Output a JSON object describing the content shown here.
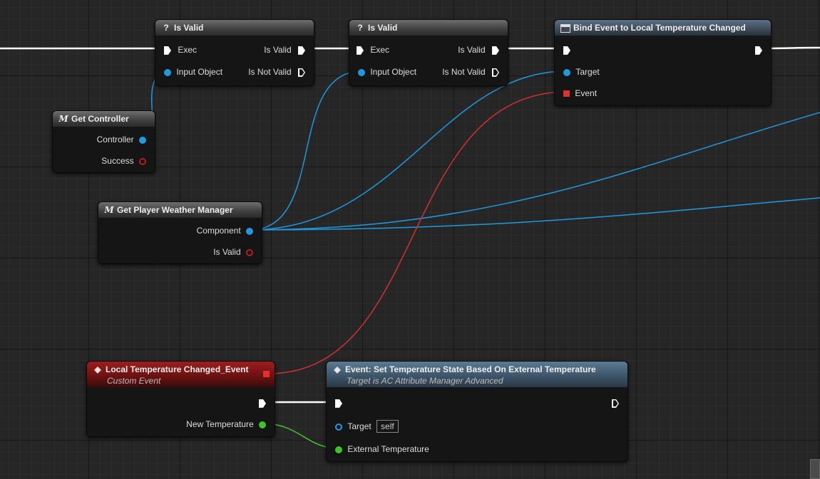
{
  "nodes": {
    "is_valid_1": {
      "title": "Is Valid",
      "icon": "?",
      "exec_in": "Exec",
      "input_object": "Input Object",
      "out_valid": "Is Valid",
      "out_not_valid": "Is Not Valid"
    },
    "is_valid_2": {
      "title": "Is Valid",
      "icon": "?",
      "exec_in": "Exec",
      "input_object": "Input Object",
      "out_valid": "Is Valid",
      "out_not_valid": "Is Not Valid"
    },
    "bind_event": {
      "title": "Bind Event to Local Temperature Changed",
      "target": "Target",
      "event": "Event"
    },
    "get_controller": {
      "title": "Get Controller",
      "icon": "M",
      "controller": "Controller",
      "success": "Success"
    },
    "get_weather": {
      "title": "Get Player Weather Manager",
      "icon": "M",
      "component": "Component",
      "is_valid": "Is Valid"
    },
    "custom_event": {
      "title": "Local Temperature Changed_Event",
      "subtitle": "Custom Event",
      "new_temperature": "New Temperature"
    },
    "set_temp": {
      "title": "Event: Set Temperature State Based On External Temperature",
      "subtitle": "Target is AC Attribute Manager Advanced",
      "target": "Target",
      "self": "self",
      "external_temperature": "External Temperature"
    }
  },
  "colors": {
    "exec_wire": "#ffffff",
    "object_wire": "#1e9be0",
    "delegate_wire": "#d03030",
    "float_wire": "#3ec32a"
  }
}
